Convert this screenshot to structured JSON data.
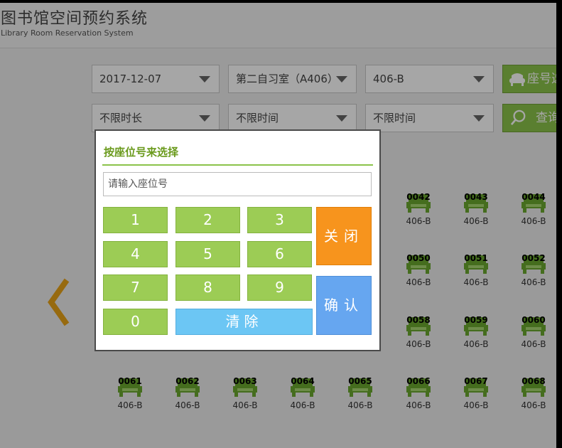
{
  "header": {
    "title": "图书馆空间预约系统",
    "subtitle": "Library Room Reservation System"
  },
  "filters": {
    "date": "2017-12-07",
    "room": "第二自习室（A406）",
    "seat_area": "406-B",
    "duration": "不限时长",
    "start_time": "不限时间",
    "end_time": "不限时间",
    "seat_button_label": "座号选",
    "search_button_label": "查询"
  },
  "seats": [
    {
      "number": "0042",
      "room": "406-B"
    },
    {
      "number": "0043",
      "room": "406-B"
    },
    {
      "number": "0044",
      "room": "406-B"
    },
    {
      "number": "0050",
      "room": "406-B"
    },
    {
      "number": "0051",
      "room": "406-B"
    },
    {
      "number": "0052",
      "room": "406-B"
    },
    {
      "number": "0058",
      "room": "406-B"
    },
    {
      "number": "0059",
      "room": "406-B"
    },
    {
      "number": "0060",
      "room": "406-B"
    },
    {
      "number": "0061",
      "room": "406-B"
    },
    {
      "number": "0062",
      "room": "406-B"
    },
    {
      "number": "0063",
      "room": "406-B"
    },
    {
      "number": "0064",
      "room": "406-B"
    },
    {
      "number": "0065",
      "room": "406-B"
    },
    {
      "number": "0066",
      "room": "406-B"
    },
    {
      "number": "0067",
      "room": "406-B"
    },
    {
      "number": "0068",
      "room": "406-B"
    }
  ],
  "dialog": {
    "title": "按座位号来选择",
    "input_placeholder": "请输入座位号",
    "keys": [
      "1",
      "2",
      "3",
      "4",
      "5",
      "6",
      "7",
      "8",
      "9",
      "0"
    ],
    "clear_label": "清除",
    "close_label": "关闭",
    "confirm_label": "确认"
  },
  "colors": {
    "accent_green": "#8bc34a",
    "close_orange": "#f7941d",
    "confirm_blue": "#66a6f0",
    "clear_blue": "#6cc6f4",
    "arrow_orange": "#e8a317"
  }
}
